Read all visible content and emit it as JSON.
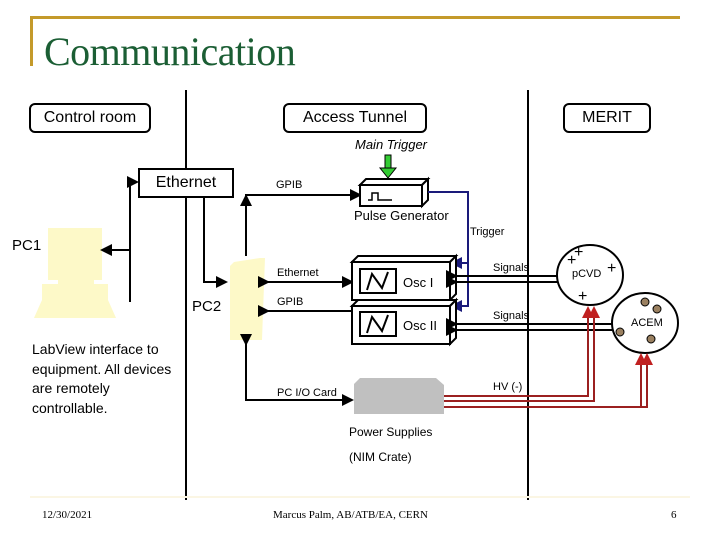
{
  "slide": {
    "title": "Communication",
    "zones": {
      "control_room": "Control room",
      "access_tunnel": "Access Tunnel",
      "merit": "MERIT"
    },
    "labels": {
      "main_trigger": "Main Trigger",
      "ethernet_switch": "Ethernet",
      "gpib_top": "GPIB",
      "pulse_generator": "Pulse Generator",
      "trigger": "Trigger",
      "pc1": "PC1",
      "pc2": "PC2",
      "ethernet_link": "Ethernet",
      "gpib_link": "GPIB",
      "osc1": "Osc I",
      "osc2": "Osc II",
      "signals1": "Signals",
      "signals2": "Signals",
      "pcvd": "pCVD",
      "acem": "ACEM",
      "pc_io_card": "PC I/O Card",
      "hv": "HV (-)",
      "power_supplies": "Power Supplies",
      "nim_crate": "(NIM Crate)"
    },
    "description": "LabView interface to equipment. All devices are remotely controllable.",
    "footer": {
      "date": "12/30/2021",
      "author": "Marcus Palm, AB/ATB/EA, CERN",
      "page": "6"
    },
    "colors": {
      "title": "#1b5e34",
      "header_rule": "#c49a2a",
      "trigger_line": "#1a1a7a",
      "hv_line": "#9b2020",
      "main_trigger_arrow": "#33cc33",
      "pc_fill": "#fdf9c8",
      "power_supply_fill": "#c0c0c0"
    }
  }
}
